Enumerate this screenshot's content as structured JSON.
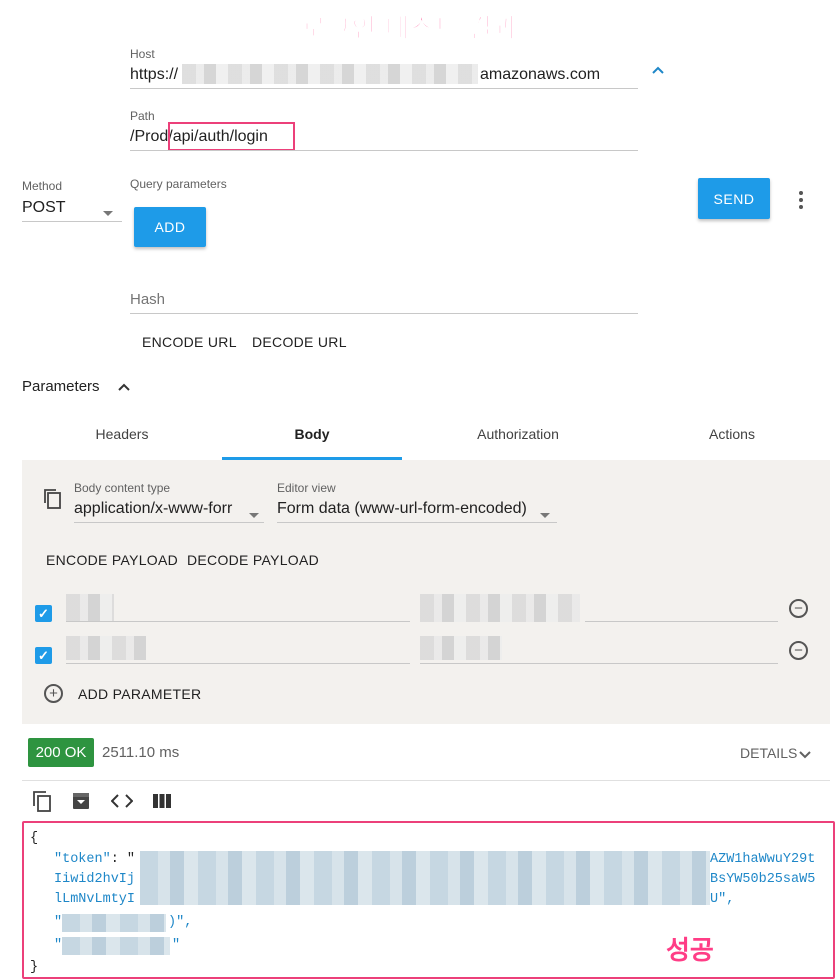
{
  "annotations": {
    "title": "로그인 테스트 결과",
    "success": "성공"
  },
  "request": {
    "host_label": "Host",
    "host_prefix": "https://",
    "host_suffix": "amazonaws.com",
    "path_label": "Path",
    "path_prefix": "/Prod",
    "path_highlight": "/api/auth/login",
    "method_label": "Method",
    "method_value": "POST",
    "query_label": "Query parameters",
    "add_label": "ADD",
    "send_label": "SEND",
    "hash_placeholder": "Hash",
    "encode_url": "ENCODE URL",
    "decode_url": "DECODE URL"
  },
  "parameters": {
    "label": "Parameters",
    "tabs": [
      "Headers",
      "Body",
      "Authorization",
      "Actions"
    ],
    "active_tab": "Body"
  },
  "body": {
    "content_type_label": "Body content type",
    "content_type_value": "application/x-www-forr",
    "editor_view_label": "Editor view",
    "editor_view_value": "Form data (www-url-form-encoded)",
    "encode_payload": "ENCODE PAYLOAD",
    "decode_payload": "DECODE PAYLOAD",
    "add_parameter": "ADD PARAMETER"
  },
  "response": {
    "status": "200 OK",
    "time": "2511.10 ms",
    "details_label": "DETAILS",
    "json_open": "{",
    "token_key": "\"token\"",
    "token_colon": ": \"",
    "token_frag_1": "AZW1haWwuY29t",
    "token_line2_start": "Iiwid2hvIj",
    "token_frag_2": "BsYW50b25saW5",
    "token_line3_start": "lLmNvLmtyI",
    "token_frag_3": "U\",",
    "line4_start": "\"",
    "line4_end": ")\",",
    "line5_start": "\"",
    "line5_end": "\"",
    "json_close": "}"
  },
  "colors": {
    "accent": "#1e9be8",
    "ok": "#2e9440",
    "highlight": "#ec407a",
    "overlay_text": "#ff3d86"
  }
}
